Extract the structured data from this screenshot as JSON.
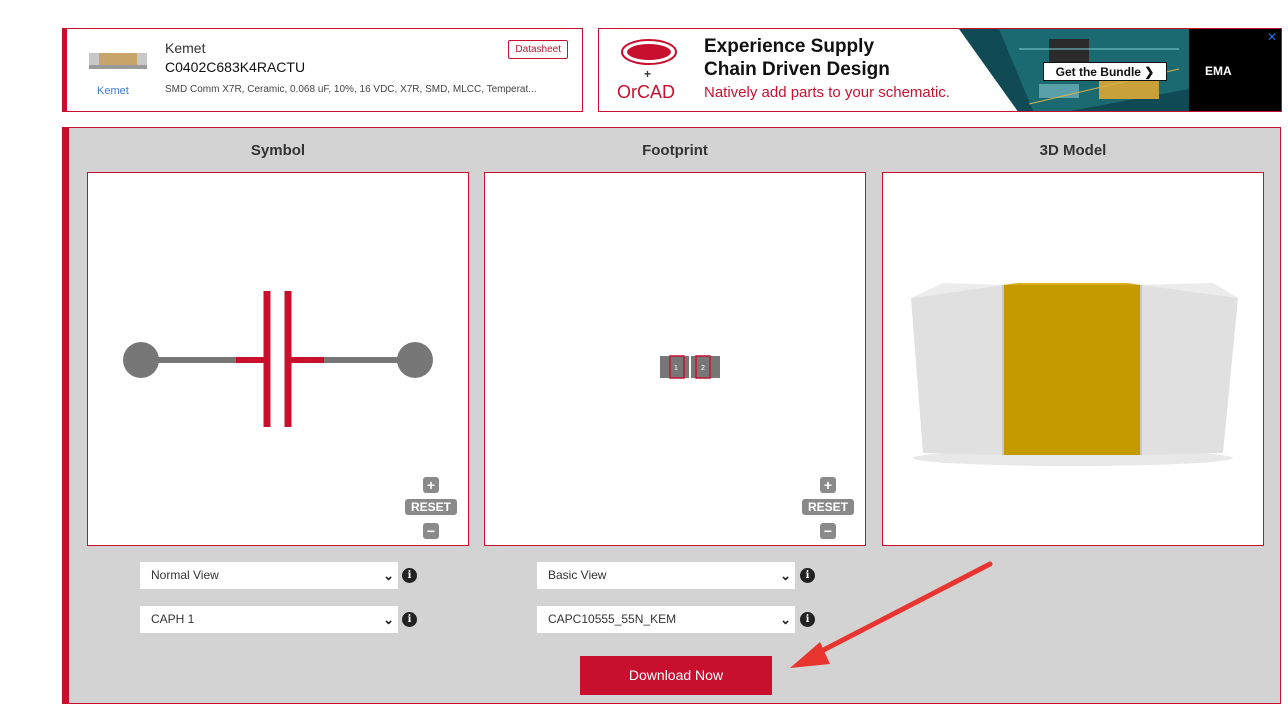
{
  "part": {
    "manufacturer": "Kemet",
    "manufacturer_link": "Kemet",
    "part_number": "C0402C683K4RACTU",
    "description": "SMD Comm X7R, Ceramic, 0.068 uF, 10%, 16 VDC, X7R, SMD, MLCC, Temperat...",
    "datasheet_label": "Datasheet"
  },
  "ad": {
    "brand1": "Digi-Key",
    "plus": "+",
    "brand2": "OrCAD",
    "headline1": "Experience Supply",
    "headline2": "Chain Driven Design",
    "subline": "Natively add parts to your schematic.",
    "cta": "Get the Bundle ❯",
    "sponsor": "EMA",
    "close_icon": "close-icon"
  },
  "panels": {
    "symbol_title": "Symbol",
    "footprint_title": "Footprint",
    "model_title": "3D Model",
    "reset_label": "RESET",
    "plus_label": "+",
    "minus_label": "−",
    "pin1": "1",
    "pin2": "2"
  },
  "controls": {
    "symbol_view": "Normal View",
    "symbol_variant": "CAPH 1",
    "footprint_view": "Basic View",
    "footprint_variant": "CAPC10555_55N_KEM",
    "info_glyph": "i",
    "chevron": "⌄"
  },
  "download_label": "Download Now",
  "colors": {
    "accent": "#c8102e",
    "panel_bg": "#d3d3d3",
    "body_gold": "#c49a00",
    "terminal_gray": "#e2e2e2",
    "wire_gray": "#777777"
  }
}
